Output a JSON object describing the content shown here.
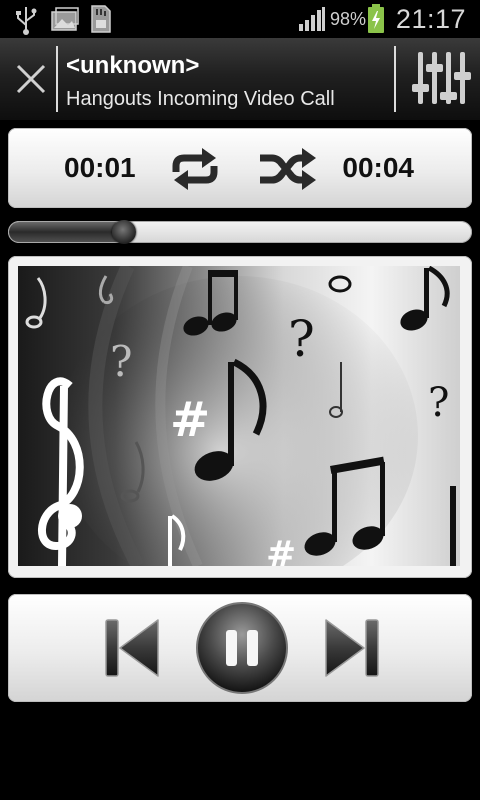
{
  "status_bar": {
    "battery_percent": "98%",
    "time": "21:17",
    "icons": [
      "usb-icon",
      "gallery-icon",
      "sd-card-icon",
      "signal-icon",
      "battery-charging-icon"
    ]
  },
  "header": {
    "title": "<unknown>",
    "subtitle": "Hangouts Incoming Video Call",
    "close_icon": "close-icon",
    "eq_icon": "equalizer-icon"
  },
  "playback": {
    "elapsed": "00:01",
    "total": "00:04",
    "repeat_icon": "repeat-icon",
    "shuffle_icon": "shuffle-icon",
    "progress": 0.25
  },
  "album_art": {
    "icon": "music-notes-artwork"
  },
  "controls": {
    "prev_icon": "skip-previous-icon",
    "pause_icon": "pause-icon",
    "next_icon": "skip-next-icon"
  }
}
